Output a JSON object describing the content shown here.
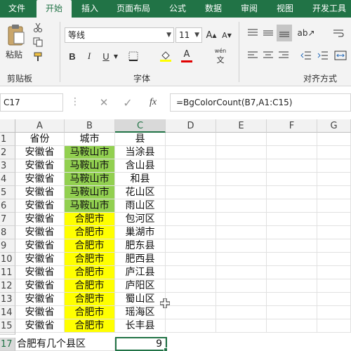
{
  "ribbon_tabs": [
    "文件",
    "开始",
    "插入",
    "页面布局",
    "公式",
    "数据",
    "审阅",
    "视图",
    "开发工具"
  ],
  "active_tab": "开始",
  "clipboard": {
    "paste_label": "粘贴",
    "group_label": "剪贴板"
  },
  "font": {
    "name": "等线",
    "size": "11",
    "group_label": "字体",
    "bold": "B",
    "italic": "I",
    "underline": "U",
    "font_color_letter": "A",
    "phonetic": "wén"
  },
  "alignment": {
    "group_label": "对齐方式"
  },
  "name_box": "C17",
  "formula_buttons": {
    "cancel": "✕",
    "enter": "✓",
    "fx": "fx"
  },
  "formula": "=BgColorCount(B7,A1:C15)",
  "columns": [
    "A",
    "B",
    "C",
    "D",
    "E",
    "F",
    "G"
  ],
  "rows": [
    {
      "num": "1",
      "a": "省份",
      "b": "城市",
      "c": "县"
    },
    {
      "num": "2",
      "a": "安徽省",
      "b": "马鞍山市",
      "c": "当涂县"
    },
    {
      "num": "3",
      "a": "安徽省",
      "b": "马鞍山市",
      "c": "含山县"
    },
    {
      "num": "4",
      "a": "安徽省",
      "b": "马鞍山市",
      "c": "和县"
    },
    {
      "num": "5",
      "a": "安徽省",
      "b": "马鞍山市",
      "c": "花山区"
    },
    {
      "num": "6",
      "a": "安徽省",
      "b": "马鞍山市",
      "c": "雨山区"
    },
    {
      "num": "7",
      "a": "安徽省",
      "b": "合肥市",
      "c": "包河区"
    },
    {
      "num": "8",
      "a": "安徽省",
      "b": "合肥市",
      "c": "巢湖市"
    },
    {
      "num": "9",
      "a": "安徽省",
      "b": "合肥市",
      "c": "肥东县"
    },
    {
      "num": "10",
      "a": "安徽省",
      "b": "合肥市",
      "c": "肥西县"
    },
    {
      "num": "11",
      "a": "安徽省",
      "b": "合肥市",
      "c": "庐江县"
    },
    {
      "num": "12",
      "a": "安徽省",
      "b": "合肥市",
      "c": "庐阳区"
    },
    {
      "num": "13",
      "a": "安徽省",
      "b": "合肥市",
      "c": "蜀山区"
    },
    {
      "num": "14",
      "a": "安徽省",
      "b": "合肥市",
      "c": "瑶海区"
    },
    {
      "num": "15",
      "a": "安徽省",
      "b": "合肥市",
      "c": "长丰县"
    }
  ],
  "row17": {
    "num": "17",
    "label": "合肥有几个县区",
    "value": "9"
  },
  "colors": {
    "excel_green": "#217346",
    "green_fill": "#92d050",
    "yellow_fill": "#ffff00"
  }
}
